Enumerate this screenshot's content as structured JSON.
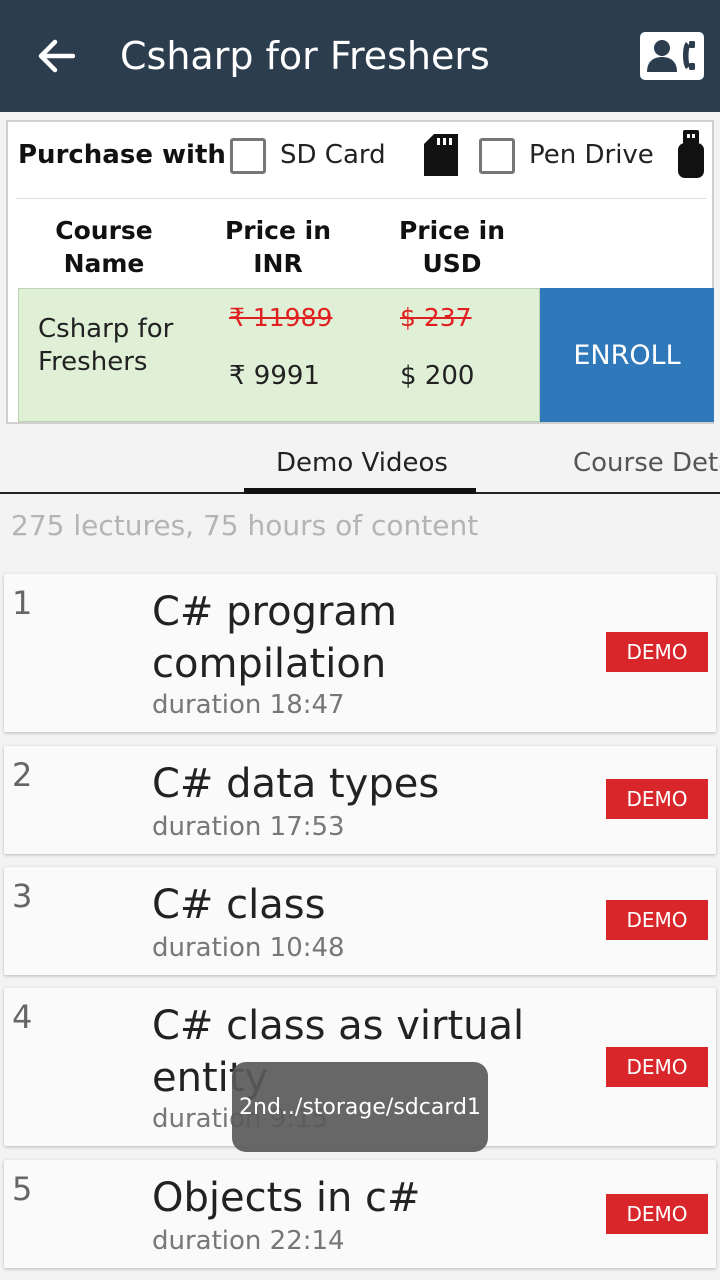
{
  "appbar": {
    "title": "Csharp for Freshers",
    "back_icon": "arrow-left-icon",
    "contact_icon": "contact-phone-icon",
    "bg_color": "#2c3e4e"
  },
  "purchase": {
    "label": "Purchase with",
    "options": [
      {
        "label": "SD Card",
        "checked": false,
        "icon": "sd-card-icon"
      },
      {
        "label": "Pen Drive",
        "checked": false,
        "icon": "usb-drive-icon"
      }
    ],
    "columns": [
      "Course Name",
      "Price in INR",
      "Price in USD"
    ],
    "course_name": "Csharp for Freshers",
    "old_inr": "₹ 11989",
    "new_inr": "₹ 9991",
    "old_usd": "$ 237",
    "new_usd": "$ 200",
    "enroll_label": "ENROLL"
  },
  "tabs": {
    "items": [
      "Demo Videos",
      "Course Deta"
    ],
    "active": 0
  },
  "summary": "275 lectures, 75 hours of content",
  "lectures": [
    {
      "num": "1",
      "title": "C# program compilation",
      "duration": "duration 18:47",
      "demo": "DEMO"
    },
    {
      "num": "2",
      "title": "C# data types",
      "duration": "duration 17:53",
      "demo": "DEMO"
    },
    {
      "num": "3",
      "title": "C# class",
      "duration": "duration 10:48",
      "demo": "DEMO"
    },
    {
      "num": "4",
      "title": "C# class as virtual entity",
      "duration": "duration 9:15",
      "demo": "DEMO"
    },
    {
      "num": "5",
      "title": "Objects in c#",
      "duration": "duration 22:14",
      "demo": "DEMO"
    }
  ],
  "toast": "2nd../storage/sdcard1"
}
